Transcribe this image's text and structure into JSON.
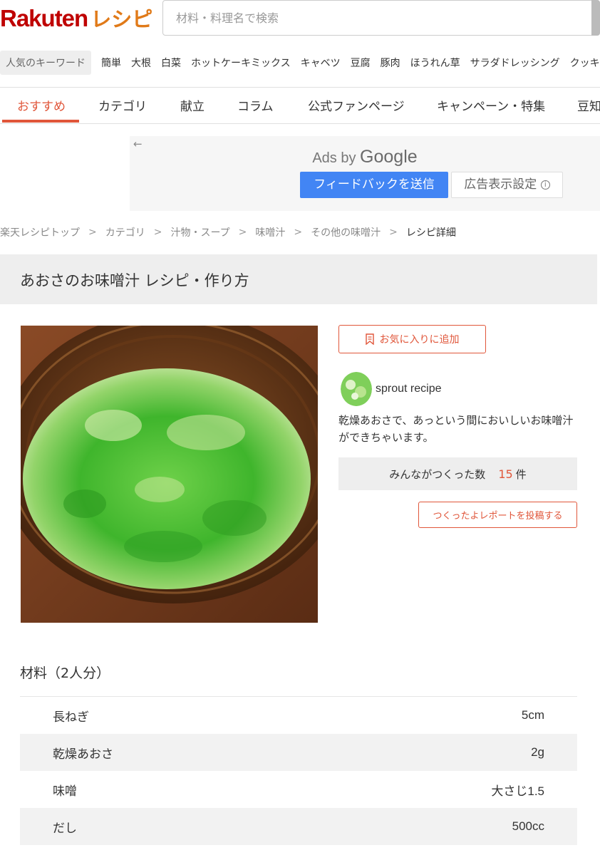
{
  "header": {
    "logo_brand": "Rakuten",
    "logo_product": "レシピ",
    "search_placeholder": "材料・料理名で検索"
  },
  "keywords": {
    "label": "人気のキーワード",
    "items": [
      "簡単",
      "大根",
      "白菜",
      "ホットケーキミックス",
      "キャベツ",
      "豆腐",
      "豚肉",
      "ほうれん草",
      "サラダドレッシング",
      "クッキー"
    ]
  },
  "nav": {
    "tabs": [
      {
        "label": "おすすめ",
        "active": true
      },
      {
        "label": "カテゴリ",
        "active": false
      },
      {
        "label": "献立",
        "active": false
      },
      {
        "label": "コラム",
        "active": false
      },
      {
        "label": "公式ファンページ",
        "active": false
      },
      {
        "label": "キャンペーン・特集",
        "active": false
      },
      {
        "label": "豆知",
        "active": false
      }
    ]
  },
  "ad": {
    "back_glyph": "←",
    "ads_by": "Ads by",
    "google": "Google",
    "feedback_label": "フィードバックを送信",
    "settings_label": "広告表示設定",
    "info_glyph": "i"
  },
  "breadcrumb": {
    "items": [
      "楽天レシピトップ",
      "カテゴリ",
      "汁物・スープ",
      "味噌汁",
      "その他の味噌汁"
    ],
    "current": "レシピ詳細",
    "separator": ">"
  },
  "recipe": {
    "title": "あおさのお味噌汁 レシピ・作り方",
    "favorite_label": "お気に入りに追加",
    "author_name": "sprout recipe",
    "description": "乾燥あおさで、あっという間においしいお味噌汁ができちゃいます。",
    "made_label": "みんながつくった数",
    "made_count": "15",
    "made_unit": "件",
    "report_label": "つくったよレポートを投稿する"
  },
  "ingredients": {
    "heading": "材料（2人分）",
    "items": [
      {
        "name": "長ねぎ",
        "amount": "5cm"
      },
      {
        "name": "乾燥あおさ",
        "amount": "2g"
      },
      {
        "name": "味噌",
        "amount": "大さじ1.5"
      },
      {
        "name": "だし",
        "amount": "500cc"
      }
    ]
  },
  "colors": {
    "accent": "#e0563a",
    "brand_red": "#bf0000",
    "brand_orange": "#e07a19",
    "ad_button_blue": "#4285f4"
  }
}
